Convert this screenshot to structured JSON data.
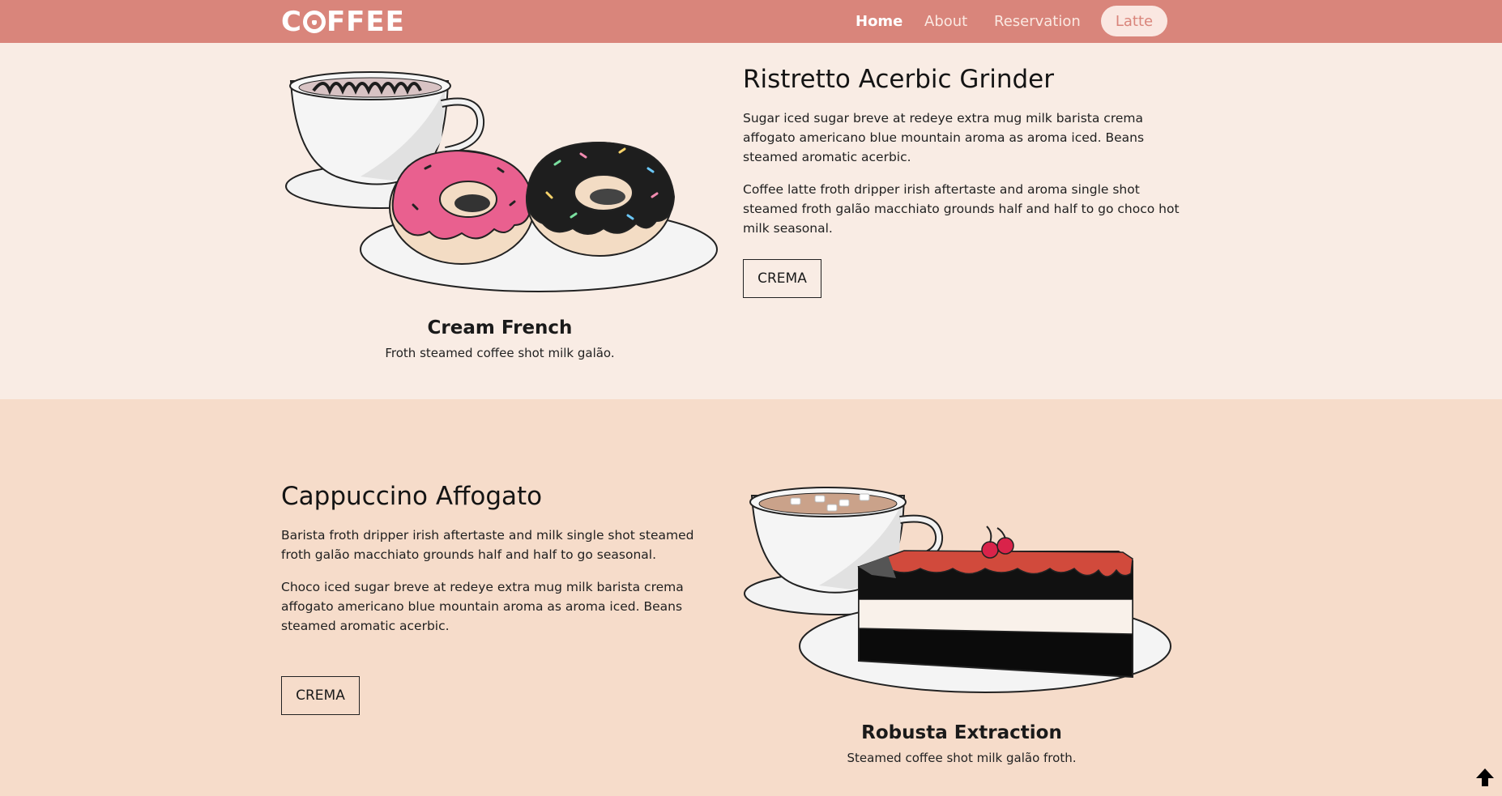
{
  "nav": {
    "logo_pre": "C",
    "logo_post": "FFEE",
    "items": [
      "Home",
      "About",
      "Reservation"
    ],
    "cta": "Latte"
  },
  "feature1": {
    "caption_title": "Cream French",
    "caption_sub": "Froth steamed coffee shot milk galão.",
    "heading": "Ristretto Acerbic Grinder",
    "para1": "Sugar iced sugar breve at redeye extra mug milk barista crema affogato americano blue mountain aroma as aroma iced. Beans steamed aromatic acerbic.",
    "para2": "Coffee latte froth dripper irish aftertaste and aroma single shot steamed froth galão macchiato grounds half and half to go choco hot milk seasonal.",
    "button": "CREMA"
  },
  "feature2": {
    "heading": "Cappuccino Affogato",
    "para1": "Barista froth dripper irish aftertaste and milk single shot steamed froth galão macchiato grounds half and half to go seasonal.",
    "para2": "Choco iced sugar breve at redeye extra mug milk barista crema affogato americano blue mountain aroma as aroma iced. Beans steamed aromatic acerbic.",
    "button": "CREMA",
    "caption_title": "Robusta Extraction",
    "caption_sub": "Steamed coffee shot milk galão froth."
  },
  "colors": {
    "navbar": "#d9857b",
    "section1_bg": "#f9ece4",
    "section2_bg": "#f6dcca",
    "pink_donut": "#e9608f",
    "chocolate": "#1e1e1e",
    "cherry": "#d9234a"
  },
  "icons": {
    "scroll_top": "arrow-up-icon"
  }
}
